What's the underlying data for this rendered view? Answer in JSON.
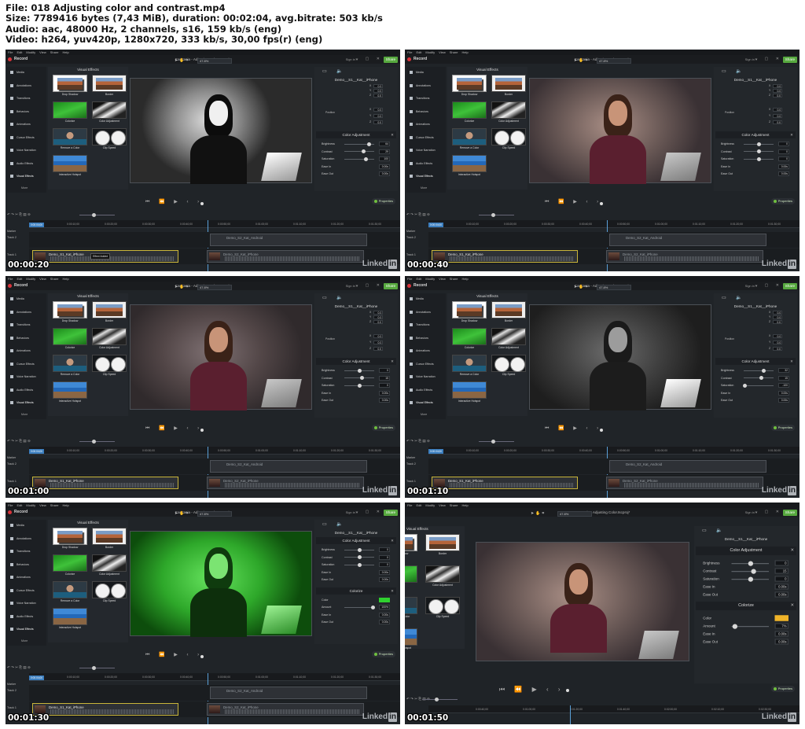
{
  "file_info": {
    "line1": "File: 018 Adjusting color and contrast.mp4",
    "line2": "Size: 7789416 bytes (7,43 MiB), duration: 00:02:04, avg.bitrate: 503 kb/s",
    "line3": "Audio: aac, 48000 Hz, 2 channels, s16, 159 kb/s (eng)",
    "line4": "Video: h264, yuv420p, 1280x720, 333 kb/s, 30,00 fps(r) (eng)"
  },
  "app": {
    "menu": [
      "File",
      "Edit",
      "Modify",
      "View",
      "Share",
      "Help"
    ],
    "window_title": "Camtasia - Adjusting Color.tscproj*",
    "record_label": "Record",
    "signin_label": "Sign in ▾",
    "share_label": "Share",
    "zoom_value": "47.8%",
    "sidebar": [
      "Media",
      "Annotations",
      "Transitions",
      "Behaviors",
      "Animations",
      "Cursor Effects",
      "Voice Narration",
      "Audio Effects",
      "Visual Effects"
    ],
    "sidebar_more": "More",
    "visual_effects_title": "Visual Effects",
    "effects": [
      "Drop Shadow",
      "Border",
      "Colorize",
      "Color Adjustment",
      "Remove a Color",
      "Clip Speed",
      "Interactive Hotspot"
    ],
    "clip_name": "Demo__S1__Kat__iPhone",
    "position_label": "Position",
    "color_adjustment_title": "Color Adjustment",
    "colorize_title": "Colorize",
    "labels": {
      "brightness": "Brightness",
      "contrast": "Contrast",
      "saturation": "Saturation",
      "ease_in": "Ease In",
      "ease_out": "Ease Out",
      "color": "Color",
      "amount": "Amount"
    },
    "properties_label": "Properties",
    "tracks": {
      "marker": "Marker",
      "track2": "Track 2",
      "track1": "Track 1"
    },
    "clip_track1": "Demo_S1_Kat_iPhone",
    "clip_track2": "Demo_S2_Kat_Android",
    "clip_track2b": "Demo_S2_Kat_iPhone",
    "ruler": [
      "0:00:00;00",
      "0:00:10;00",
      "0:00:20;00",
      "0:00:30;00",
      "0:00:40;00",
      "0:00:50;00",
      "0:01:00;00",
      "0:01:10;00",
      "0:01:20;00",
      "0:01:30;00"
    ],
    "ruler_big": [
      "0:00:40;00",
      "0:01:00;00",
      "0:01:20;00",
      "0:01:40;00",
      "0:02:00;00",
      "0:02:10;00",
      "0:02:30;00"
    ],
    "playhead_tag": "0:00:04;00",
    "tooltip_effect_added": "Effect Added",
    "linkedin": "Linked",
    "linkedin_in": "in"
  },
  "frames": [
    {
      "timestamp": "00:00:20",
      "brightness": "64",
      "contrast": "29",
      "saturation": "100",
      "ease_in": "0.00s",
      "ease_out": "0.00s",
      "xyz": [
        "0.0",
        "0.0",
        "0.0"
      ],
      "position": [
        "0.0",
        "0.0",
        "0.0"
      ],
      "bri_frac": 0.82,
      "con_frac": 0.62,
      "sat_frac": 0.7
    },
    {
      "timestamp": "00:00:40",
      "brightness": "0",
      "contrast": "0",
      "saturation": "0",
      "ease_in": "0.00s",
      "ease_out": "0.00s",
      "xyz": [
        "0.0",
        "0.0",
        "0.0"
      ],
      "position": [
        "0.0",
        "0.0",
        "0.0"
      ],
      "bri_frac": 0.5,
      "con_frac": 0.5,
      "sat_frac": 0.5
    },
    {
      "timestamp": "00:01:00",
      "brightness": "0",
      "contrast": "15",
      "saturation": "0",
      "ease_in": "0.00s",
      "ease_out": "0.00s",
      "xyz": [
        "0.0",
        "0.0",
        "0.0"
      ],
      "position": [
        "0.0",
        "0.0",
        "0.0"
      ],
      "bri_frac": 0.5,
      "con_frac": 0.58,
      "sat_frac": 0.5
    },
    {
      "timestamp": "00:01:10",
      "brightness": "32",
      "contrast": "15",
      "saturation": "-100",
      "ease_in": "0.00s",
      "ease_out": "0.00s",
      "xyz": [
        "0.0",
        "0.0",
        "0.0"
      ],
      "position": [
        "0.0",
        "0.0",
        "0.0"
      ],
      "bri_frac": 0.66,
      "con_frac": 0.58,
      "sat_frac": 0.02
    },
    {
      "timestamp": "00:01:30",
      "brightness": "0",
      "contrast": "0",
      "saturation": "0",
      "ease_in": "0.00s",
      "ease_out": "0.00s",
      "colorize_amount": "100%",
      "colorize_color": "#2fd12f",
      "amount_frac": 0.95,
      "bri_frac": 0.5,
      "con_frac": 0.5,
      "sat_frac": 0.5
    },
    {
      "timestamp": "00:01:50",
      "brightness": "0",
      "contrast": "15",
      "saturation": "0",
      "ease_in": "0.00s",
      "ease_out": "0.00s",
      "colorize_amount": "7%",
      "colorize_color": "#f0b429",
      "amount_frac": 0.07,
      "bri_frac": 0.5,
      "con_frac": 0.58,
      "sat_frac": 0.5
    }
  ],
  "colors": {
    "share_green": "#57a93f",
    "record_red": "#d8333a",
    "clip_border": "#c9b53a",
    "playhead": "#5aa0d8"
  }
}
